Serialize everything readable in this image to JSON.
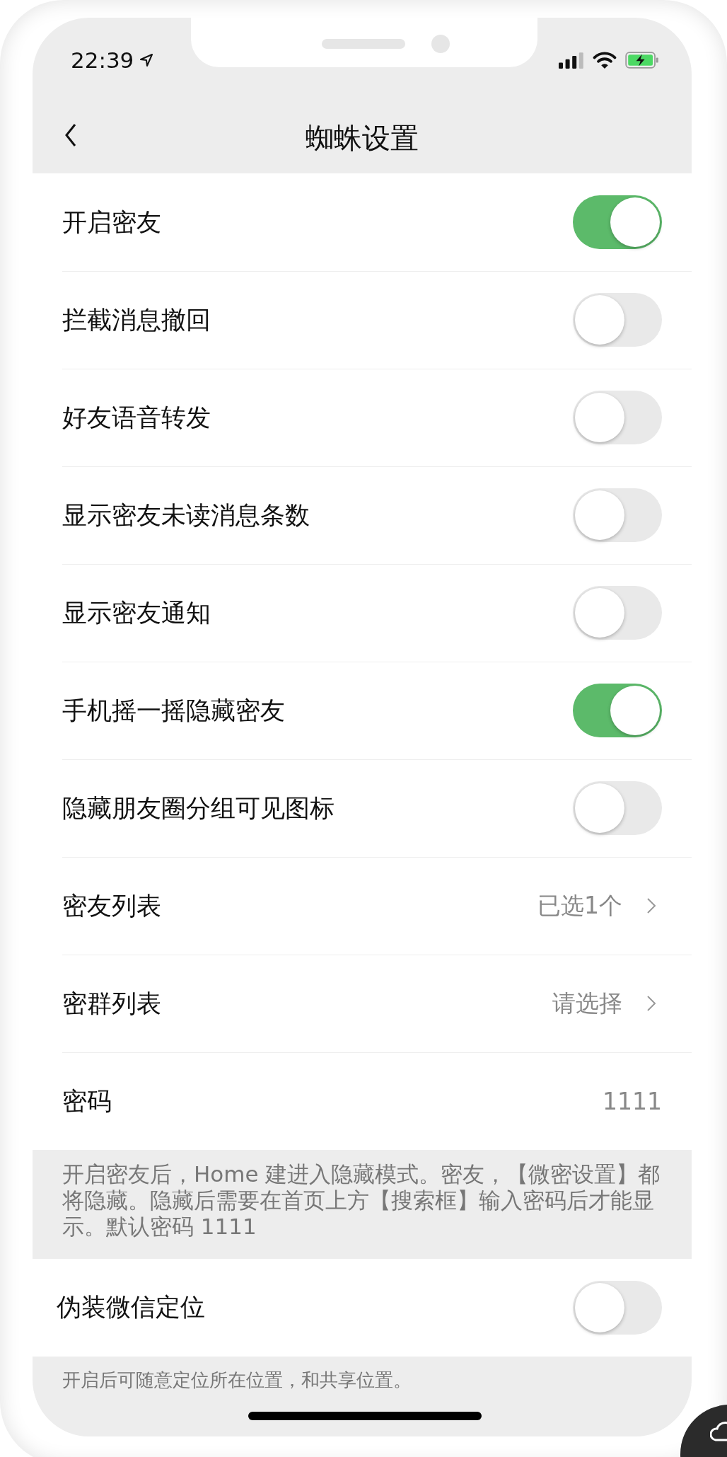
{
  "status_bar": {
    "time": "22:39"
  },
  "nav": {
    "title": "蜘蛛设置"
  },
  "sections": [
    {
      "rows": [
        {
          "kind": "toggle",
          "label": "开启密友",
          "on": true
        },
        {
          "kind": "toggle",
          "label": "拦截消息撤回",
          "on": false
        },
        {
          "kind": "toggle",
          "label": "好友语音转发",
          "on": false
        },
        {
          "kind": "toggle",
          "label": "显示密友未读消息条数",
          "on": false
        },
        {
          "kind": "toggle",
          "label": "显示密友通知",
          "on": false
        },
        {
          "kind": "toggle",
          "label": "手机摇一摇隐藏密友",
          "on": true
        },
        {
          "kind": "toggle",
          "label": "隐藏朋友圈分组可见图标",
          "on": false
        },
        {
          "kind": "link",
          "label": "密友列表",
          "value": "已选1个"
        },
        {
          "kind": "link",
          "label": "密群列表",
          "value": "请选择"
        },
        {
          "kind": "value",
          "label": "密码",
          "value": "1111"
        }
      ],
      "note": "开启密友后，Home 建进入隐藏模式。密友，【微密设置】都将隐藏。隐藏后需要在首页上方【搜索框】输入密码后才能显示。默认密码 1111"
    },
    {
      "rows": [
        {
          "kind": "toggle",
          "label": "伪装微信定位",
          "on": false
        }
      ],
      "note": "开启后可随意定位所在位置，和共享位置。"
    }
  ]
}
